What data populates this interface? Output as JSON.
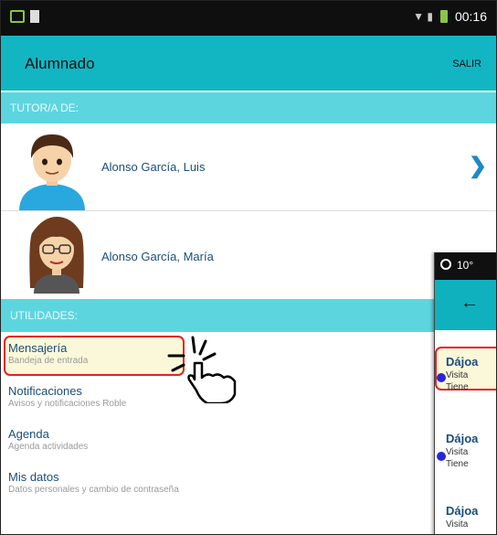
{
  "status_bar": {
    "time": "00:16"
  },
  "app_bar": {
    "title": "Alumnado",
    "action": "SALIR"
  },
  "tutor_section": {
    "header": "TUTOR/A DE:",
    "students": [
      {
        "name": "Alonso García, Luis",
        "avatar": "boy-avatar"
      },
      {
        "name": "Alonso García, María",
        "avatar": "girl-avatar"
      }
    ]
  },
  "utilities_section": {
    "header": "UTILIDADES:",
    "items": [
      {
        "title": "Mensajería",
        "subtitle": "Bandeja de entrada"
      },
      {
        "title": "Notificaciones",
        "subtitle": "Avisos y notificaciones Roble"
      },
      {
        "title": "Agenda",
        "subtitle": "Agenda actividades"
      },
      {
        "title": "Mis datos",
        "subtitle": "Datos personales y cambio de contraseña"
      }
    ]
  },
  "overlay_phone": {
    "status_text": "10°",
    "messages": [
      {
        "title": "Dájoa",
        "line1": "Visita",
        "line2": "Tiene"
      },
      {
        "title": "Dájoa",
        "line1": "Visita",
        "line2": "Tiene"
      },
      {
        "title": "Dájoa",
        "line1": "Visita"
      }
    ]
  },
  "colors": {
    "accent": "#12b6c3",
    "section": "#5dd5df",
    "link": "#1a4d7c",
    "highlight_border": "#e52222"
  }
}
